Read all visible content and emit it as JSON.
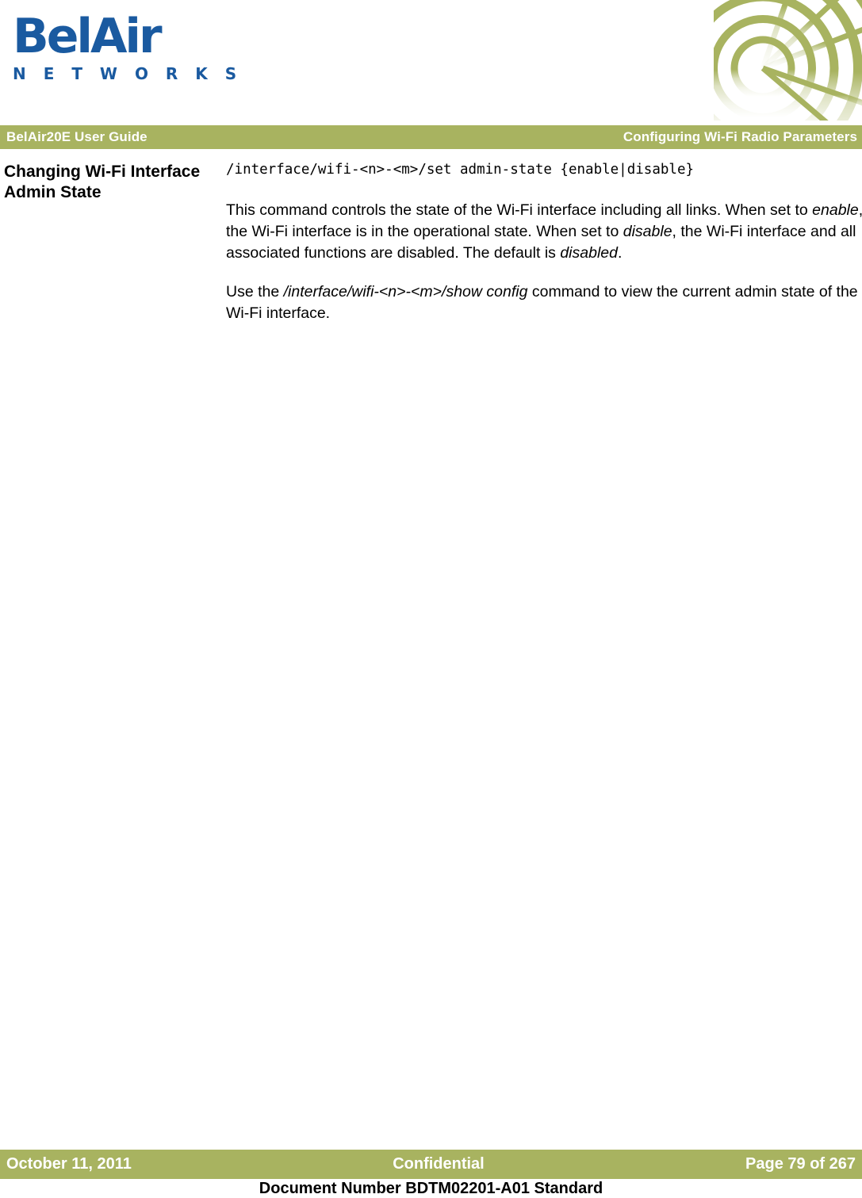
{
  "brand": {
    "logo_word": "BelAir",
    "logo_subtitle": "N E T W O R K S",
    "logo_color": "#1A5AA0",
    "accent_color": "#A8B360",
    "decor_icon": "wireless-web-arcs-graphic"
  },
  "header": {
    "left_title": "BelAir20E User Guide",
    "right_title": "Configuring Wi-Fi Radio Parameters"
  },
  "section": {
    "heading": "Changing Wi-Fi Interface Admin State",
    "command": "/interface/wifi-<n>-<m>/set admin-state {enable|disable}",
    "paragraph1": {
      "part1": "This command controls the state of the Wi-Fi interface including all links. When set to ",
      "em1": "enable",
      "part2": ", the Wi-Fi interface is in the operational state. When set to ",
      "em2": "disable",
      "part3": ", the Wi-Fi interface and all associated functions are disabled. The default is ",
      "em3": "disabled",
      "part4": "."
    },
    "paragraph2": {
      "part1": "Use the ",
      "em1": "/interface/wifi-<n>-<m>/show config",
      "part2": " command to view the current admin state of the Wi-Fi interface."
    }
  },
  "footer": {
    "date": "October 11, 2011",
    "confidentiality": "Confidential",
    "page": "Page 79 of 267",
    "document_number": "Document Number BDTM02201-A01 Standard"
  }
}
